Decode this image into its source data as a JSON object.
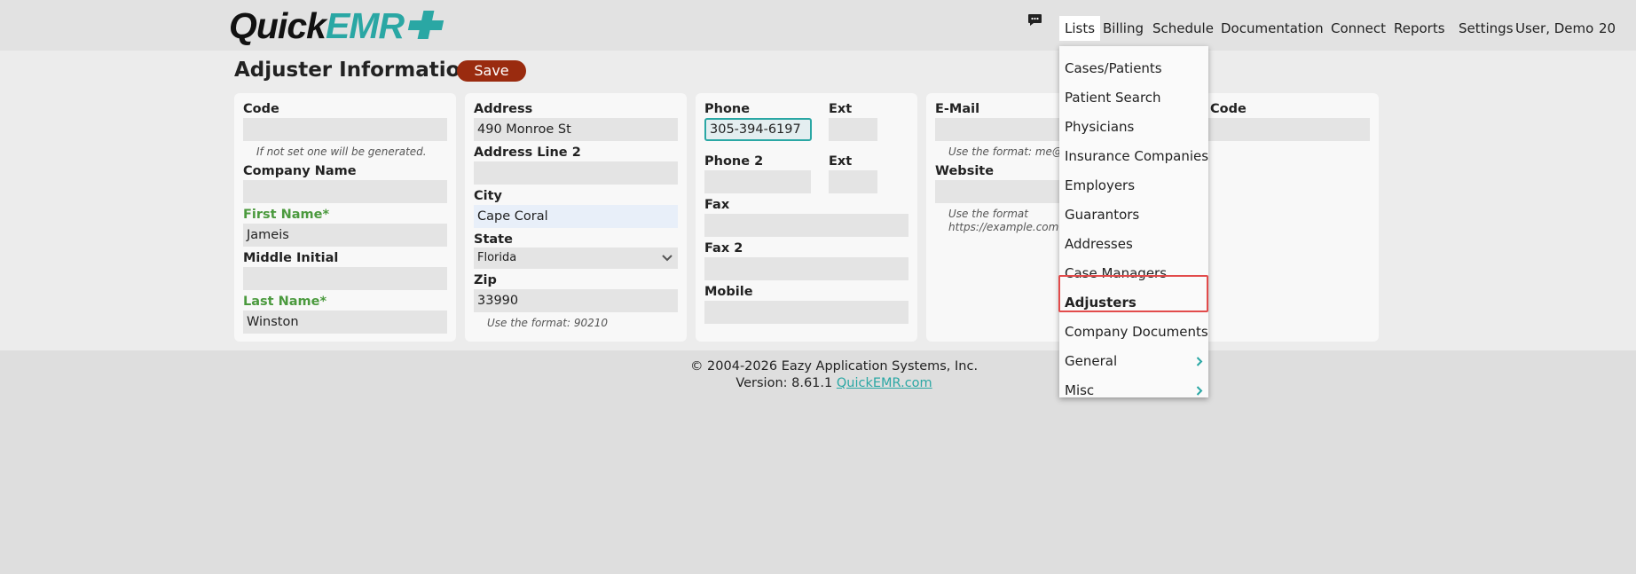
{
  "brand": {
    "logo_quick": "Quick",
    "logo_emr": "EMR",
    "accent_color": "#2aa7a4"
  },
  "nav": {
    "items": [
      {
        "label": "Lists",
        "active": true
      },
      {
        "label": "Billing"
      },
      {
        "label": "Schedule"
      },
      {
        "label": "Documentation"
      },
      {
        "label": "Connect"
      },
      {
        "label": "Reports"
      },
      {
        "label": "Settings"
      },
      {
        "label": "User, Demo"
      },
      {
        "label": "20"
      }
    ]
  },
  "page": {
    "title": "Adjuster Information",
    "save_label": "Save"
  },
  "form": {
    "code_label": "Code",
    "code_value": "",
    "code_hint": "If not set one will be generated.",
    "company_label": "Company Name",
    "company_value": "",
    "first_name_label": "First Name*",
    "first_name_value": "Jameis",
    "middle_initial_label": "Middle Initial",
    "middle_initial_value": "",
    "last_name_label": "Last Name*",
    "last_name_value": "Winston",
    "address_label": "Address",
    "address_value": "490 Monroe St",
    "address2_label": "Address Line 2",
    "address2_value": "",
    "city_label": "City",
    "city_value": "Cape Coral",
    "state_label": "State",
    "state_value": "Florida",
    "zip_label": "Zip",
    "zip_value": "33990",
    "zip_hint": "Use the format: 90210",
    "phone_label": "Phone",
    "phone_value": "305-394-6197",
    "ext_label": "Ext",
    "ext_value": "",
    "phone2_label": "Phone 2",
    "phone2_value": "",
    "ext2_label": "Ext",
    "ext2_value": "",
    "fax_label": "Fax",
    "fax_value": "",
    "fax2_label": "Fax 2",
    "fax2_value": "",
    "mobile_label": "Mobile",
    "mobile_value": "",
    "email_label": "E-Mail",
    "email_value": "",
    "email_hint": "Use the format: me@",
    "website_label": "Website",
    "website_value": "",
    "website_hint_1": "Use the format",
    "website_hint_2": "https://example.com",
    "code2_label": "Code",
    "code2_value": ""
  },
  "dropdown": {
    "items": [
      {
        "label": "Cases/Patients"
      },
      {
        "label": "Patient Search"
      },
      {
        "label": "Physicians"
      },
      {
        "label": "Insurance Companies"
      },
      {
        "label": "Employers"
      },
      {
        "label": "Guarantors"
      },
      {
        "label": "Addresses"
      },
      {
        "label": "Case Managers"
      },
      {
        "label": "Adjusters",
        "selected": true
      },
      {
        "label": "Company Documents"
      },
      {
        "label": "General",
        "submenu": true
      },
      {
        "label": "Misc",
        "submenu": true
      }
    ]
  },
  "footer": {
    "copyright": "© 2004-2026 Eazy Application Systems, Inc.",
    "version": "Version: 8.61.1",
    "link": "QuickEMR.com"
  }
}
